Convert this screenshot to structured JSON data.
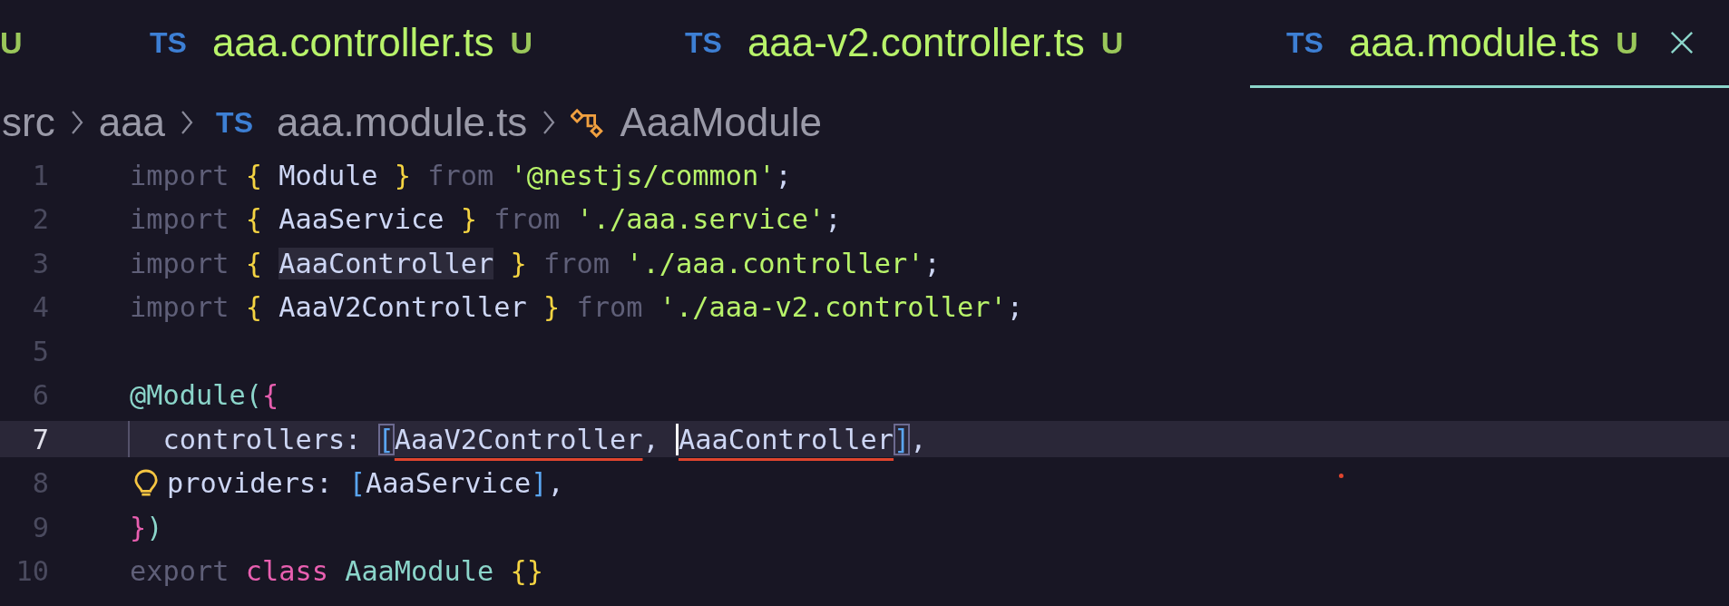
{
  "tabs": [
    {
      "status": "U",
      "selected": false
    },
    {
      "badge": "TS",
      "label": "aaa.controller.ts",
      "status": "U",
      "selected": false
    },
    {
      "badge": "TS",
      "label": "aaa-v2.controller.ts",
      "status": "U",
      "selected": false
    },
    {
      "badge": "TS",
      "label": "aaa.module.ts",
      "status": "U",
      "selected": true
    }
  ],
  "breadcrumbs": [
    {
      "kind": "folder",
      "label": "src"
    },
    {
      "kind": "folder",
      "label": "aaa"
    },
    {
      "kind": "file",
      "badge": "TS",
      "label": "aaa.module.ts"
    },
    {
      "kind": "symbol",
      "label": "AaaModule"
    }
  ],
  "code": [
    {
      "number": "1",
      "current": false,
      "lightbulb": false,
      "tokens": [
        {
          "kind": "keyword",
          "text": "import "
        },
        {
          "kind": "brace",
          "text": "{ "
        },
        {
          "kind": "ident",
          "text": "Module"
        },
        {
          "kind": "brace",
          "text": " }"
        },
        {
          "kind": "keyword",
          "text": " from "
        },
        {
          "kind": "string",
          "text": "'@nestjs/common'"
        },
        {
          "kind": "punct",
          "text": ";"
        }
      ]
    },
    {
      "number": "2",
      "current": false,
      "lightbulb": false,
      "tokens": [
        {
          "kind": "keyword",
          "text": "import "
        },
        {
          "kind": "brace",
          "text": "{ "
        },
        {
          "kind": "ident",
          "text": "AaaService"
        },
        {
          "kind": "brace",
          "text": " }"
        },
        {
          "kind": "keyword",
          "text": " from "
        },
        {
          "kind": "string",
          "text": "'./aaa.service'"
        },
        {
          "kind": "punct",
          "text": ";"
        }
      ]
    },
    {
      "number": "3",
      "current": false,
      "lightbulb": false,
      "tokens": [
        {
          "kind": "keyword",
          "text": "import "
        },
        {
          "kind": "brace",
          "text": "{ "
        },
        {
          "kind": "highlight",
          "text": "AaaController"
        },
        {
          "kind": "brace",
          "text": " }"
        },
        {
          "kind": "keyword",
          "text": " from "
        },
        {
          "kind": "string",
          "text": "'./aaa.controller'"
        },
        {
          "kind": "punct",
          "text": ";"
        }
      ]
    },
    {
      "number": "4",
      "current": false,
      "lightbulb": false,
      "tokens": [
        {
          "kind": "keyword",
          "text": "import "
        },
        {
          "kind": "brace",
          "text": "{ "
        },
        {
          "kind": "ident",
          "text": "AaaV2Controller"
        },
        {
          "kind": "brace",
          "text": " }"
        },
        {
          "kind": "keyword",
          "text": " from "
        },
        {
          "kind": "string",
          "text": "'./aaa-v2.controller'"
        },
        {
          "kind": "punct",
          "text": ";"
        }
      ]
    },
    {
      "number": "5",
      "current": false,
      "lightbulb": false
    },
    {
      "number": "6",
      "current": false,
      "lightbulb": false,
      "tokens": [
        {
          "kind": "decorator",
          "text": "@Module("
        },
        {
          "kind": "pink",
          "text": "{"
        }
      ]
    },
    {
      "number": "7",
      "current": true,
      "lightbulb": false,
      "tokens": [
        {
          "kind": "ident",
          "text": "  controllers: "
        },
        {
          "kind": "bracket",
          "text": "["
        },
        {
          "kind": "error",
          "text": "AaaV2Controller"
        },
        {
          "kind": "ident",
          "text": ", "
        },
        {
          "kind": "error-cursor",
          "text": "AaaController"
        },
        {
          "kind": "bracket",
          "text": "]"
        },
        {
          "kind": "ident",
          "text": ","
        }
      ]
    },
    {
      "number": "8",
      "current": false,
      "lightbulb": true,
      "tokens": [
        {
          "kind": "ident",
          "text": "providers: "
        },
        {
          "kind": "blue",
          "text": "["
        },
        {
          "kind": "ident",
          "text": "AaaService"
        },
        {
          "kind": "blue",
          "text": "]"
        },
        {
          "kind": "ident",
          "text": ","
        }
      ]
    },
    {
      "number": "9",
      "current": false,
      "lightbulb": false,
      "tokens": [
        {
          "kind": "pink",
          "text": "}"
        },
        {
          "kind": "decorator",
          "text": ")"
        }
      ]
    },
    {
      "number": "10",
      "current": false,
      "lightbulb": false,
      "tokens": [
        {
          "kind": "keyword",
          "text": "export "
        },
        {
          "kind": "pink",
          "text": "class "
        },
        {
          "kind": "decorator",
          "text": "AaaModule "
        },
        {
          "kind": "brace",
          "text": "{}"
        }
      ]
    }
  ]
}
